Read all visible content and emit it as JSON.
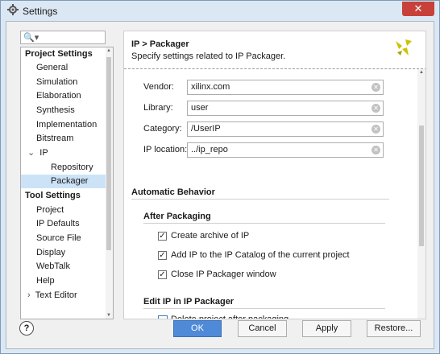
{
  "window": {
    "title": "Settings",
    "close_glyph": "✕"
  },
  "search": {
    "icon": "search-icon",
    "glyph": "🔍▾"
  },
  "tree": {
    "items": [
      {
        "label": "Project Settings",
        "kind": "header"
      },
      {
        "label": "General"
      },
      {
        "label": "Simulation"
      },
      {
        "label": "Elaboration"
      },
      {
        "label": "Synthesis"
      },
      {
        "label": "Implementation"
      },
      {
        "label": "Bitstream"
      },
      {
        "label": "IP",
        "expander": "⌄"
      },
      {
        "label": "Repository"
      },
      {
        "label": "Packager",
        "selected": true
      },
      {
        "label": "Tool Settings",
        "kind": "header"
      },
      {
        "label": "Project"
      },
      {
        "label": "IP Defaults"
      },
      {
        "label": "Source File"
      },
      {
        "label": "Display"
      },
      {
        "label": "WebTalk"
      },
      {
        "label": "Help"
      },
      {
        "label": "Text Editor",
        "expander": "›"
      }
    ]
  },
  "content": {
    "title": "IP > Packager",
    "subtitle": "Specify settings related to IP Packager.",
    "fields": [
      {
        "label": "Vendor:",
        "value": "xilinx.com"
      },
      {
        "label": "Library:",
        "value": "user"
      },
      {
        "label": "Category:",
        "value": "/UserIP"
      },
      {
        "label": "IP location:",
        "value": "../ip_repo"
      }
    ],
    "automatic_behavior": "Automatic Behavior",
    "after_packaging": "After Packaging",
    "after_packaging_options": [
      {
        "label": "Create archive of IP",
        "checked": true
      },
      {
        "label": "Add IP to the IP Catalog of the current project",
        "checked": true
      },
      {
        "label": "Close IP Packager window",
        "checked": true
      }
    ],
    "edit_ip": "Edit IP in IP Packager",
    "edit_ip_options": [
      {
        "label": "Delete project after packaging",
        "checked": false
      }
    ],
    "check_glyph": "✓"
  },
  "footer": {
    "help": "?",
    "ok": "OK",
    "cancel": "Cancel",
    "apply": "Apply",
    "restore": "Restore..."
  },
  "colors": {
    "accent": "#4f8ad9",
    "selected": "#cce2f7",
    "close": "#c7413a",
    "logo": "#c9c400"
  }
}
